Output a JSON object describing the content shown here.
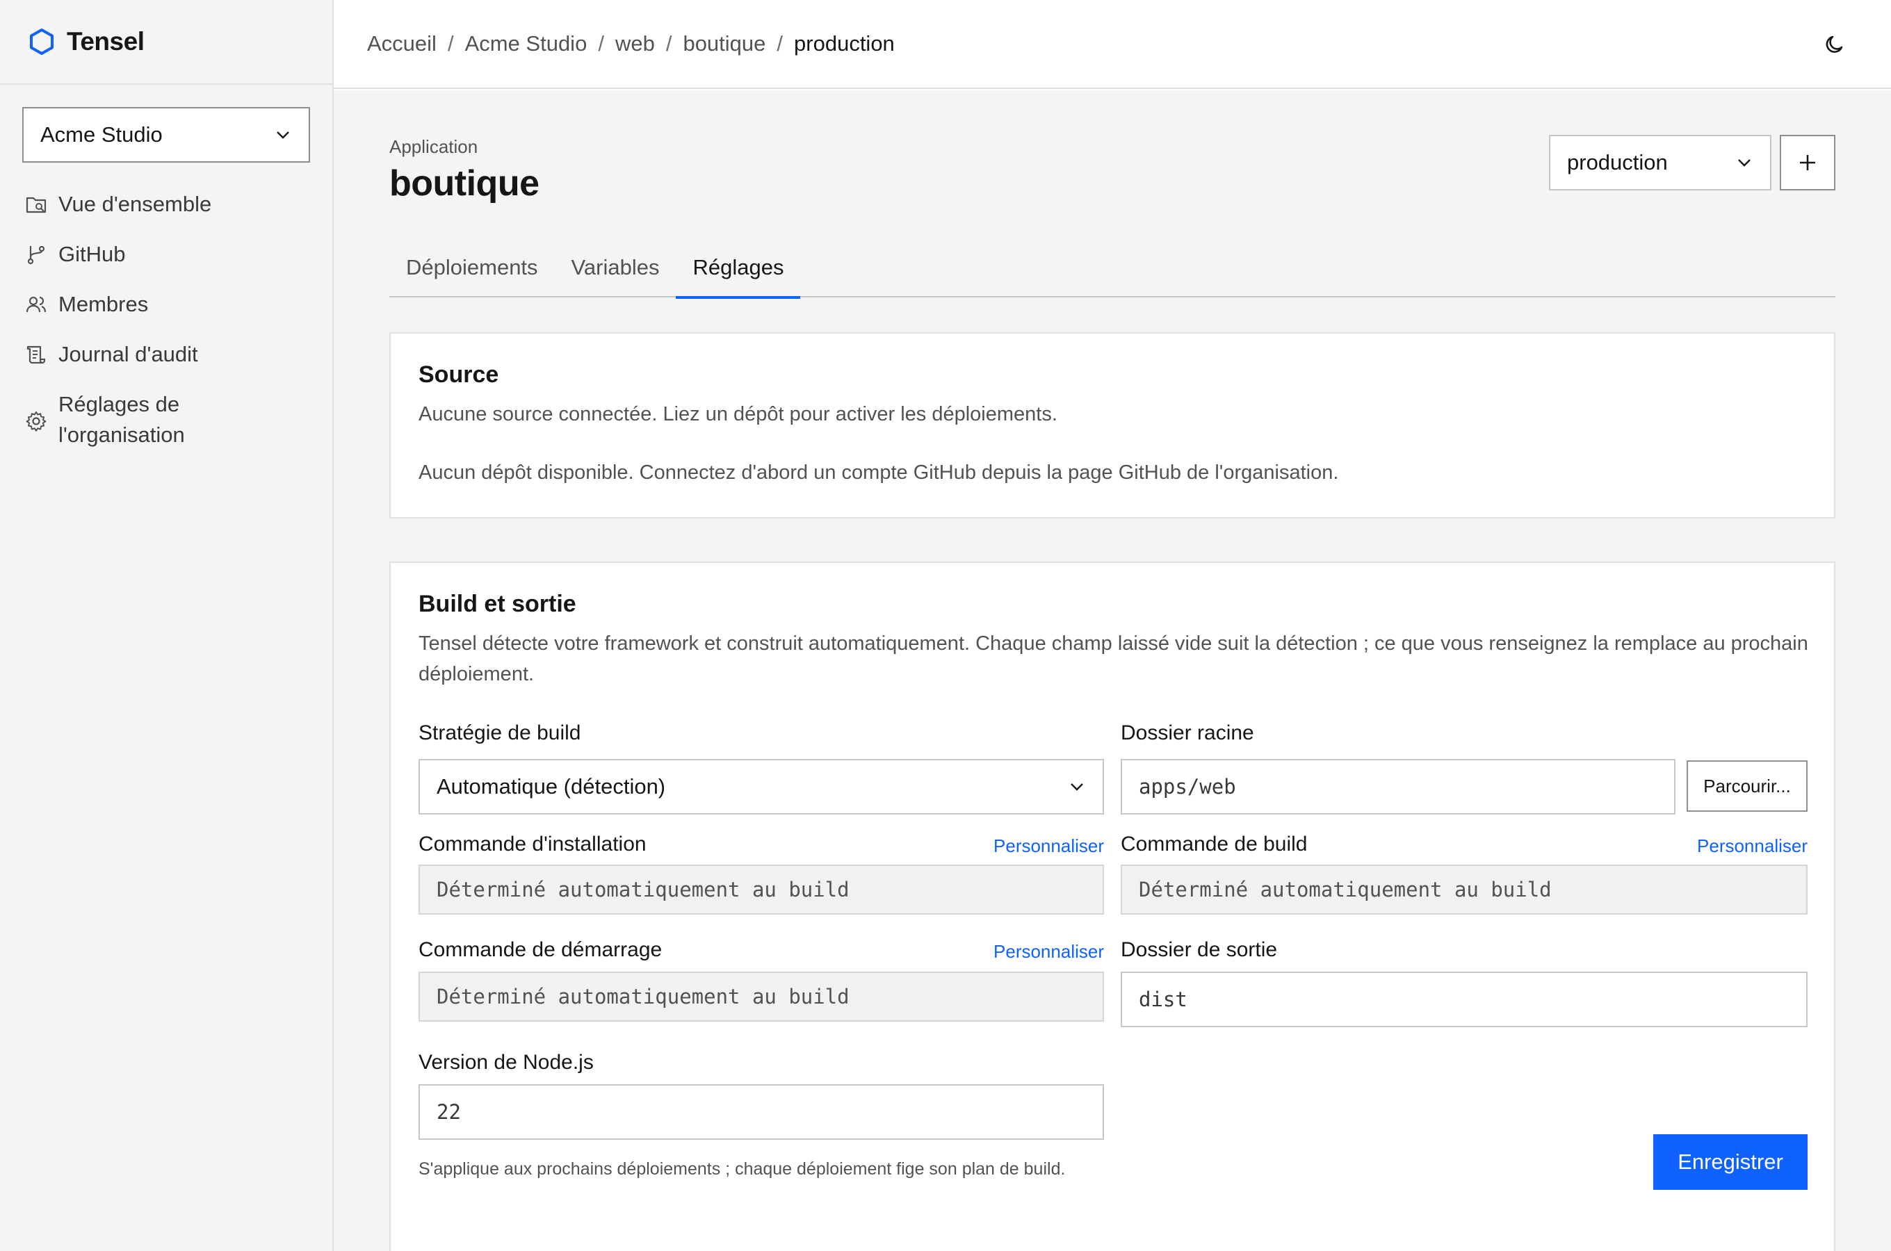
{
  "app": {
    "name": "Tensel",
    "accent": "#0f62fe"
  },
  "sidebar": {
    "org": "Acme Studio",
    "items": [
      {
        "label": "Vue d'ensemble",
        "icon": "folder-icon"
      },
      {
        "label": "GitHub",
        "icon": "branch-icon"
      },
      {
        "label": "Membres",
        "icon": "users-icon"
      },
      {
        "label": "Journal d'audit",
        "icon": "scroll-icon"
      },
      {
        "label": "Réglages de l'organisation",
        "icon": "gear-icon"
      }
    ]
  },
  "breadcrumb": [
    "Accueil",
    "Acme Studio",
    "web",
    "boutique",
    "production"
  ],
  "breadcrumb_separator": "/",
  "page": {
    "subtitle": "Application",
    "title": "boutique",
    "environment": "production"
  },
  "tabs": [
    "Déploiements",
    "Variables",
    "Réglages"
  ],
  "active_tab": "Réglages",
  "source": {
    "title": "Source",
    "line1": "Aucune source connectée. Liez un dépôt pour activer les déploiements.",
    "line2": "Aucun dépôt disponible. Connectez d'abord un compte GitHub depuis la page GitHub de l'organisation."
  },
  "build": {
    "title": "Build et sortie",
    "description": "Tensel détecte votre framework et construit automatiquement. Chaque champ laissé vide suit la détection ; ce que vous renseignez la remplace au prochain déploiement.",
    "strategy_label": "Stratégie de build",
    "strategy_value": "Automatique (détection)",
    "root_label": "Dossier racine",
    "root_value": "apps/web",
    "browse_label": "Parcourir...",
    "install_label": "Commande d'installation",
    "install_value": "Déterminé automatiquement au build",
    "build_cmd_label": "Commande de build",
    "build_cmd_value": "Déterminé automatiquement au build",
    "start_label": "Commande de démarrage",
    "start_value": "Déterminé automatiquement au build",
    "output_label": "Dossier de sortie",
    "output_value": "dist",
    "node_label": "Version de Node.js",
    "node_value": "22",
    "customize_label": "Personnaliser",
    "footnote": "S'applique aux prochains déploiements ; chaque déploiement fige son plan de build.",
    "save_label": "Enregistrer"
  }
}
